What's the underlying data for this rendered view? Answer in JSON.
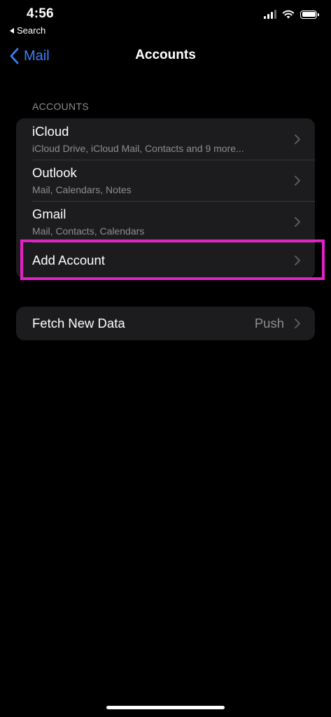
{
  "status_bar": {
    "time": "4:56",
    "back_app": "Search",
    "signal_icon": "cellular-signal-icon",
    "wifi_icon": "wifi-icon",
    "battery_icon": "battery-icon"
  },
  "nav": {
    "back_label": "Mail",
    "title": "Accounts",
    "accent_color": "#3b82f6"
  },
  "accounts_section": {
    "header": "ACCOUNTS",
    "items": [
      {
        "title": "iCloud",
        "subtitle": "iCloud Drive, iCloud Mail, Contacts and 9 more..."
      },
      {
        "title": "Outlook",
        "subtitle": "Mail, Calendars, Notes"
      },
      {
        "title": "Gmail",
        "subtitle": "Mail, Contacts, Calendars"
      }
    ],
    "add_account": "Add Account"
  },
  "fetch": {
    "label": "Fetch New Data",
    "value": "Push"
  },
  "highlight_color": "#e61ec8"
}
